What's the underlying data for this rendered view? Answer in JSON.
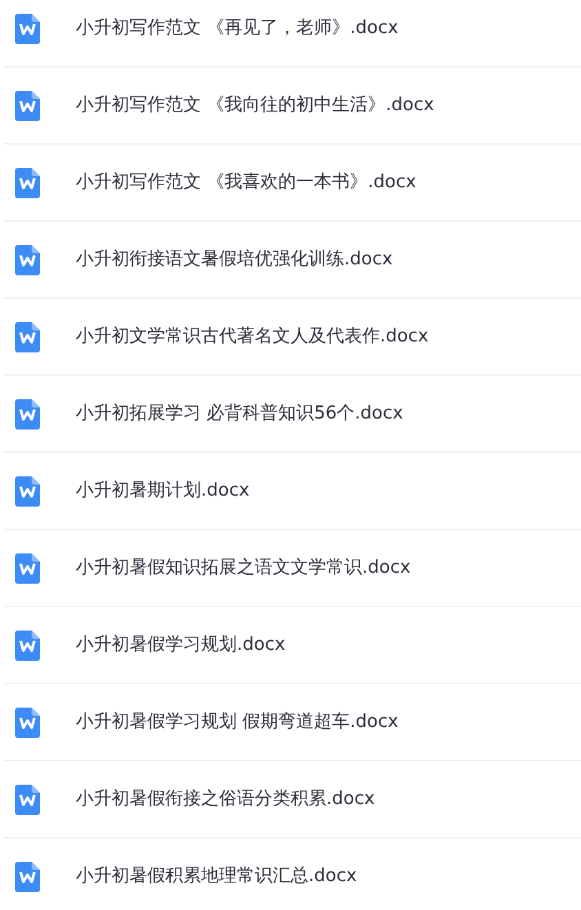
{
  "files": [
    {
      "name": "小升初写作范文 《再见了，老师》.docx"
    },
    {
      "name": "小升初写作范文 《我向往的初中生活》.docx"
    },
    {
      "name": "小升初写作范文 《我喜欢的一本书》.docx"
    },
    {
      "name": "小升初衔接语文暑假培优强化训练.docx"
    },
    {
      "name": "小升初文学常识古代著名文人及代表作.docx"
    },
    {
      "name": "小升初拓展学习 必背科普知识56个.docx"
    },
    {
      "name": "小升初暑期计划.docx"
    },
    {
      "name": "小升初暑假知识拓展之语文文学常识.docx"
    },
    {
      "name": "小升初暑假学习规划.docx"
    },
    {
      "name": "小升初暑假学习规划 假期弯道超车.docx"
    },
    {
      "name": "小升初暑假衔接之俗语分类积累.docx"
    },
    {
      "name": "小升初暑假积累地理常识汇总.docx"
    }
  ]
}
